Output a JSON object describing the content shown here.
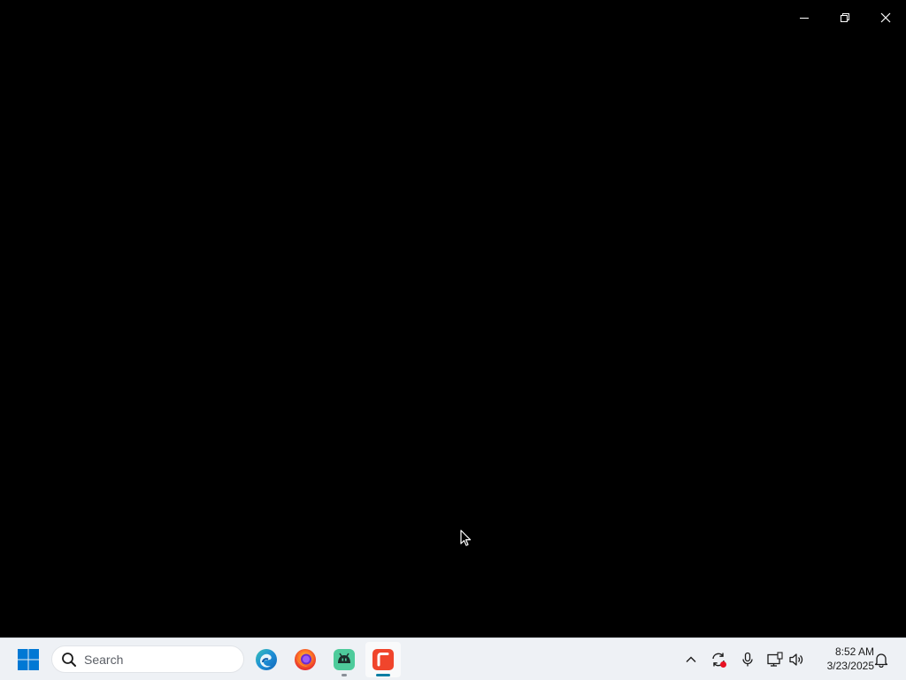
{
  "window": {
    "controls": {
      "minimize": "minimize-icon",
      "restore": "restore-icon",
      "close": "close-icon"
    }
  },
  "taskbar": {
    "search": {
      "placeholder": "Search"
    },
    "apps": [
      {
        "name": "Microsoft Edge",
        "icon": "edge-icon"
      },
      {
        "name": "Firefox",
        "icon": "firefox-icon"
      },
      {
        "name": "Android App",
        "icon": "android-app-icon"
      },
      {
        "name": "Active App",
        "icon": "red-app-icon",
        "active": true
      }
    ],
    "tray": {
      "icons": [
        "chevron-up-icon",
        "sync-icon",
        "microphone-icon",
        "network-icon",
        "volume-icon",
        "notification-icon"
      ]
    },
    "clock": {
      "time": "8:52 AM",
      "date": "3/23/2025"
    }
  },
  "colors": {
    "window_background": "#000000",
    "taskbar_background": "#eef1f5",
    "windows_blue": "#0078d4",
    "active_indicator": "#0a7ea4"
  }
}
